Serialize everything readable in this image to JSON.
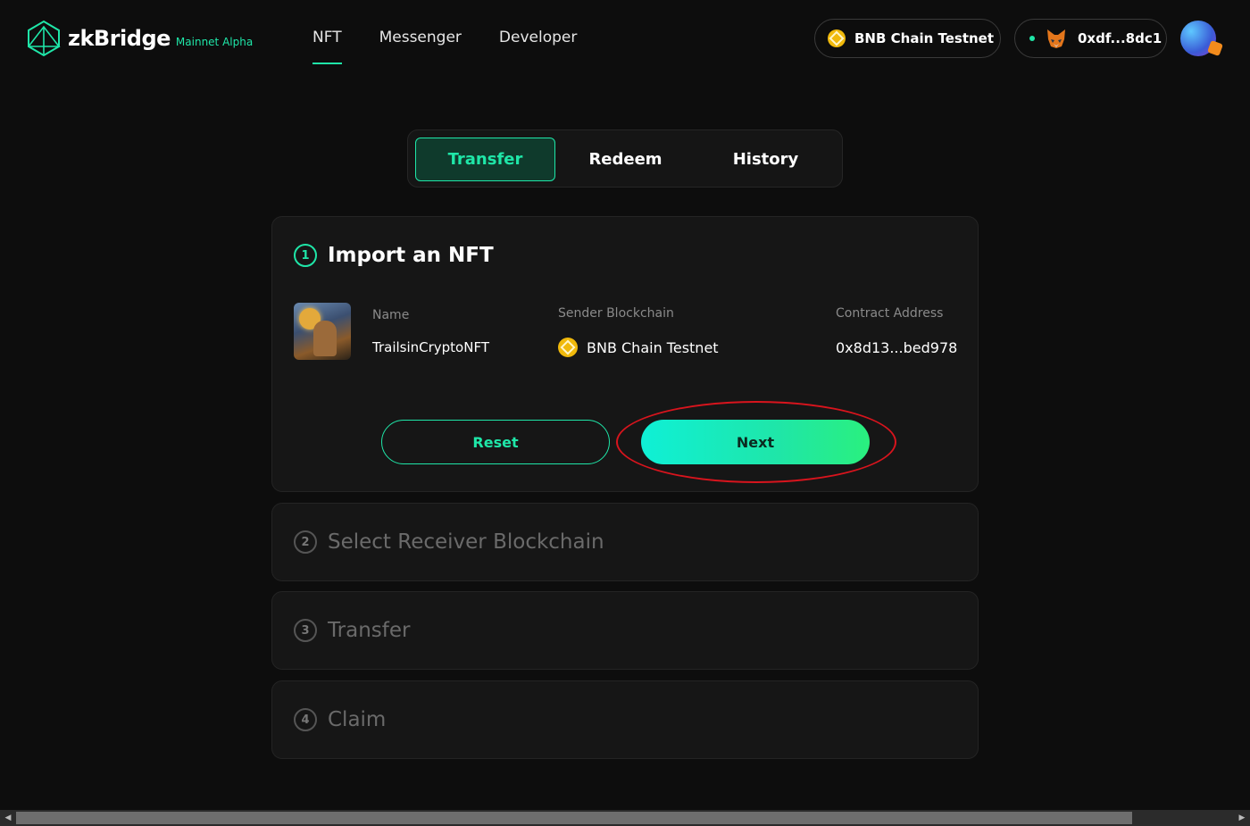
{
  "brand": {
    "name": "zkBridge",
    "tag": "Mainnet Alpha",
    "accent": "#1fe6a8"
  },
  "nav": {
    "items": [
      "NFT",
      "Messenger",
      "Developer"
    ],
    "active": "NFT"
  },
  "header": {
    "chain": "BNB Chain Testnet",
    "wallet": "0xdf...8dc1"
  },
  "tabs": {
    "items": [
      "Transfer",
      "Redeem",
      "History"
    ],
    "active": "Transfer"
  },
  "steps": [
    {
      "num": "1",
      "title": "Import an NFT"
    },
    {
      "num": "2",
      "title": "Select Receiver Blockchain"
    },
    {
      "num": "3",
      "title": "Transfer"
    },
    {
      "num": "4",
      "title": "Claim"
    }
  ],
  "nft": {
    "name_label": "Name",
    "name": "TrailsinCryptoNFT",
    "sender_label": "Sender Blockchain",
    "sender": "BNB Chain Testnet",
    "contract_label": "Contract Address",
    "contract": "0x8d13...bed978"
  },
  "buttons": {
    "reset": "Reset",
    "next": "Next"
  }
}
